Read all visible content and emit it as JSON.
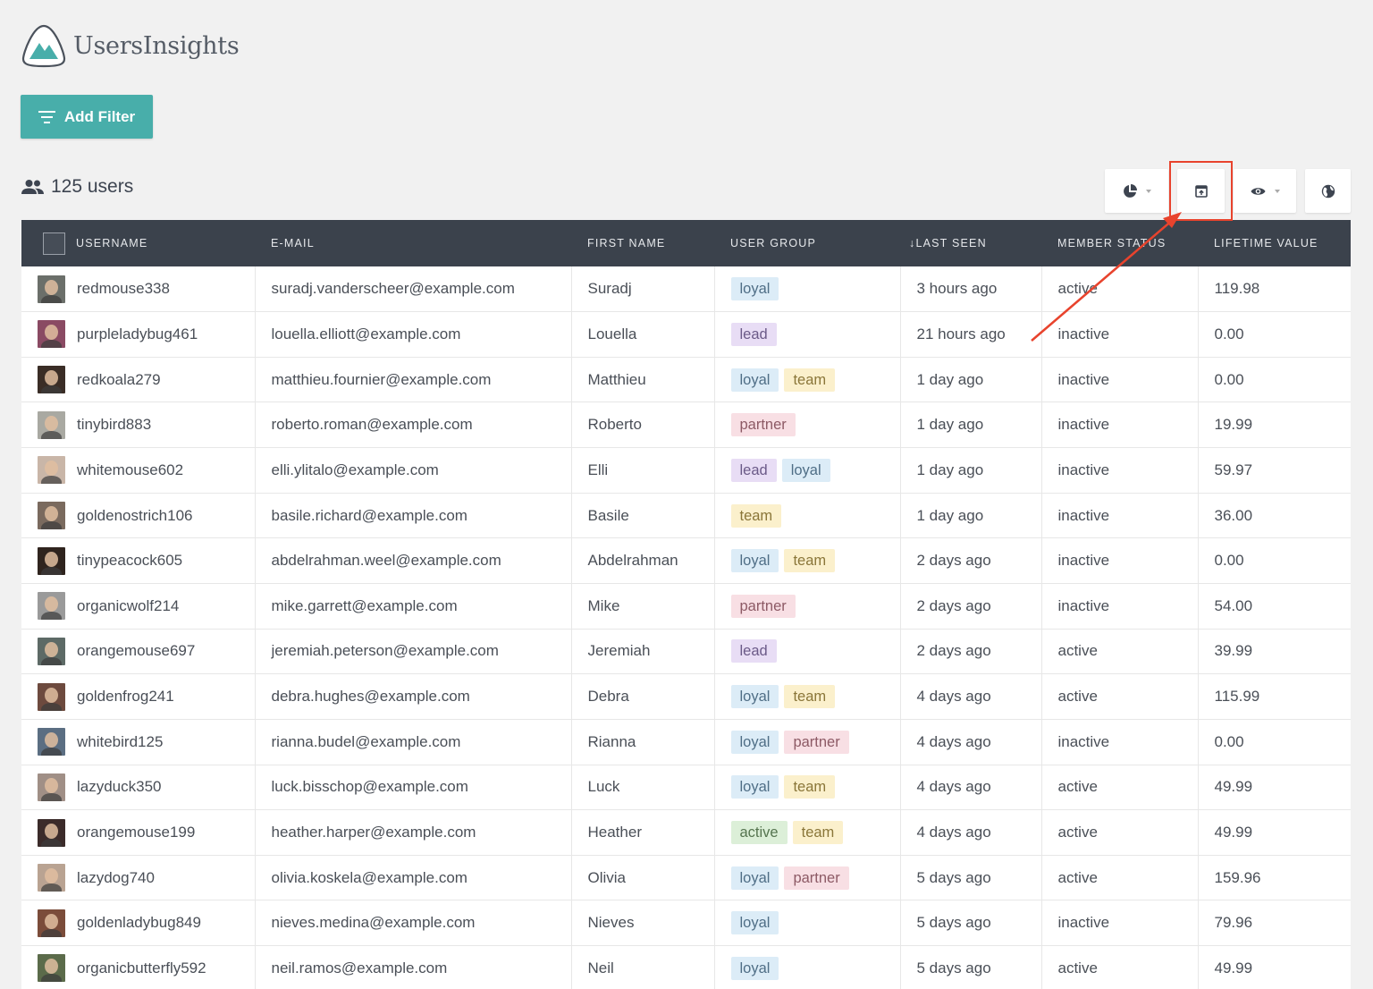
{
  "app": {
    "name": "UsersInsights"
  },
  "filter_button": {
    "label": "Add Filter"
  },
  "summary": {
    "count_label": "125 users"
  },
  "toolbar": {
    "segments_icon": "pie-chart-icon",
    "export_icon": "export-icon",
    "columns_icon": "eye-icon",
    "geo_icon": "globe-icon"
  },
  "annotation": {
    "color": "#e8432d"
  },
  "colors": {
    "accent": "#48aeaa",
    "header_bg": "#3b424c"
  },
  "table": {
    "headers": {
      "username": "USERNAME",
      "email": "E-MAIL",
      "first_name": "FIRST NAME",
      "user_group": "USER GROUP",
      "last_seen": "LAST SEEN",
      "sort_indicator": "↓",
      "member_status": "MEMBER STATUS",
      "lifetime_value": "LIFETIME VALUE"
    },
    "rows": [
      {
        "username": "redmouse338",
        "email": "suradj.vanderscheer@example.com",
        "first_name": "Suradj",
        "groups": [
          "loyal"
        ],
        "last_seen": "3 hours ago",
        "status": "active",
        "value": "119.98",
        "avatar_color": "#6b6f6a"
      },
      {
        "username": "purpleladybug461",
        "email": "louella.elliott@example.com",
        "first_name": "Louella",
        "groups": [
          "lead"
        ],
        "last_seen": "21 hours ago",
        "status": "inactive",
        "value": "0.00",
        "avatar_color": "#8a4a63"
      },
      {
        "username": "redkoala279",
        "email": "matthieu.fournier@example.com",
        "first_name": "Matthieu",
        "groups": [
          "loyal",
          "team"
        ],
        "last_seen": "1 day ago",
        "status": "inactive",
        "value": "0.00",
        "avatar_color": "#3a2d26"
      },
      {
        "username": "tinybird883",
        "email": "roberto.roman@example.com",
        "first_name": "Roberto",
        "groups": [
          "partner"
        ],
        "last_seen": "1 day ago",
        "status": "inactive",
        "value": "19.99",
        "avatar_color": "#a9a9a2"
      },
      {
        "username": "whitemouse602",
        "email": "elli.ylitalo@example.com",
        "first_name": "Elli",
        "groups": [
          "lead",
          "loyal"
        ],
        "last_seen": "1 day ago",
        "status": "inactive",
        "value": "59.97",
        "avatar_color": "#c9b6a8"
      },
      {
        "username": "goldenostrich106",
        "email": "basile.richard@example.com",
        "first_name": "Basile",
        "groups": [
          "team"
        ],
        "last_seen": "1 day ago",
        "status": "inactive",
        "value": "36.00",
        "avatar_color": "#7a6a5e"
      },
      {
        "username": "tinypeacock605",
        "email": "abdelrahman.weel@example.com",
        "first_name": "Abdelrahman",
        "groups": [
          "loyal",
          "team"
        ],
        "last_seen": "2 days ago",
        "status": "inactive",
        "value": "0.00",
        "avatar_color": "#2f241e"
      },
      {
        "username": "organicwolf214",
        "email": "mike.garrett@example.com",
        "first_name": "Mike",
        "groups": [
          "partner"
        ],
        "last_seen": "2 days ago",
        "status": "inactive",
        "value": "54.00",
        "avatar_color": "#9a9a9a"
      },
      {
        "username": "orangemouse697",
        "email": "jeremiah.peterson@example.com",
        "first_name": "Jeremiah",
        "groups": [
          "lead"
        ],
        "last_seen": "2 days ago",
        "status": "active",
        "value": "39.99",
        "avatar_color": "#5d6a66"
      },
      {
        "username": "goldenfrog241",
        "email": "debra.hughes@example.com",
        "first_name": "Debra",
        "groups": [
          "loyal",
          "team"
        ],
        "last_seen": "4 days ago",
        "status": "active",
        "value": "115.99",
        "avatar_color": "#6d4a3e"
      },
      {
        "username": "whitebird125",
        "email": "rianna.budel@example.com",
        "first_name": "Rianna",
        "groups": [
          "loyal",
          "partner"
        ],
        "last_seen": "4 days ago",
        "status": "inactive",
        "value": "0.00",
        "avatar_color": "#5b6e82"
      },
      {
        "username": "lazyduck350",
        "email": "luck.bisschop@example.com",
        "first_name": "Luck",
        "groups": [
          "loyal",
          "team"
        ],
        "last_seen": "4 days ago",
        "status": "active",
        "value": "49.99",
        "avatar_color": "#a08f86"
      },
      {
        "username": "orangemouse199",
        "email": "heather.harper@example.com",
        "first_name": "Heather",
        "groups": [
          "active",
          "team"
        ],
        "last_seen": "4 days ago",
        "status": "active",
        "value": "49.99",
        "avatar_color": "#3b2b2a"
      },
      {
        "username": "lazydog740",
        "email": "olivia.koskela@example.com",
        "first_name": "Olivia",
        "groups": [
          "loyal",
          "partner"
        ],
        "last_seen": "5 days ago",
        "status": "active",
        "value": "159.96",
        "avatar_color": "#b9a392"
      },
      {
        "username": "goldenladybug849",
        "email": "nieves.medina@example.com",
        "first_name": "Nieves",
        "groups": [
          "loyal"
        ],
        "last_seen": "5 days ago",
        "status": "inactive",
        "value": "79.96",
        "avatar_color": "#7b4c3a"
      },
      {
        "username": "organicbutterfly592",
        "email": "neil.ramos@example.com",
        "first_name": "Neil",
        "groups": [
          "loyal"
        ],
        "last_seen": "5 days ago",
        "status": "active",
        "value": "49.99",
        "avatar_color": "#5b6b4a"
      }
    ]
  }
}
